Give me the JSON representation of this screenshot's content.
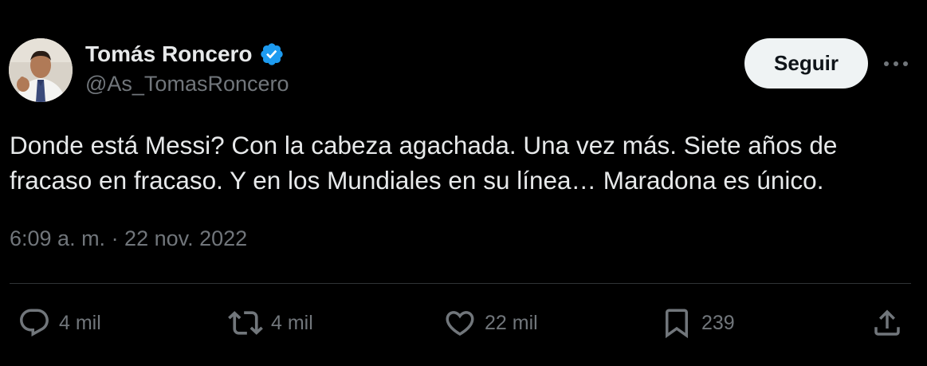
{
  "author": {
    "display_name": "Tomás Roncero",
    "handle": "@As_TomasRoncero",
    "verified": true,
    "avatar": "avatar-photo"
  },
  "header": {
    "follow_label": "Seguir",
    "more_icon": "more-horizontal-icon"
  },
  "tweet": {
    "text": "Donde está Messi? Con la cabeza agachada. Una vez más. Siete años de\nfracaso en fracaso. Y en los Mundiales en su línea… Maradona es único.",
    "timestamp": "6:09 a. m. · 22 nov. 2022"
  },
  "actions": {
    "reply": {
      "icon": "reply-icon",
      "count": "4 mil"
    },
    "retweet": {
      "icon": "retweet-icon",
      "count": "4 mil"
    },
    "like": {
      "icon": "heart-icon",
      "count": "22 mil"
    },
    "bookmark": {
      "icon": "bookmark-icon",
      "count": "239"
    },
    "share": {
      "icon": "share-icon"
    }
  },
  "colors": {
    "background": "#000000",
    "text_primary": "#e7e9ea",
    "text_secondary": "#71767b",
    "verified_blue": "#1d9bf0",
    "follow_button_bg": "#eff3f4",
    "divider": "#2f3336"
  }
}
